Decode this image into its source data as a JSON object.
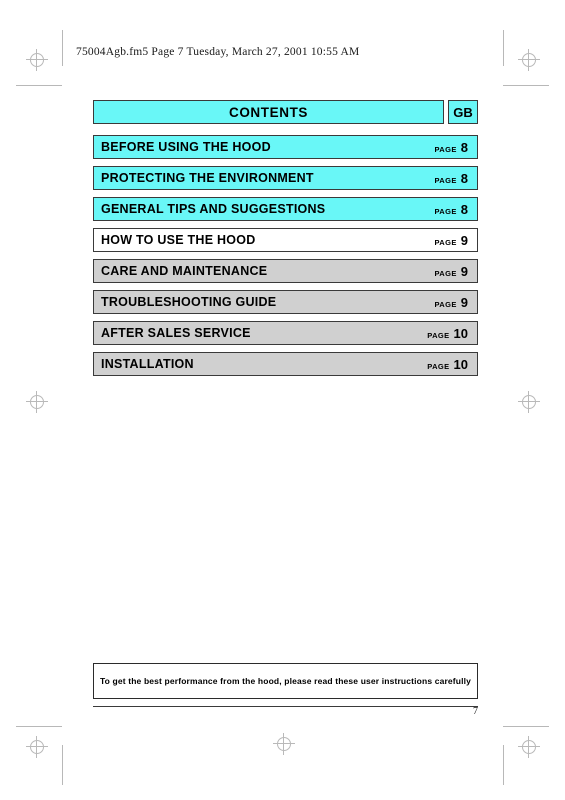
{
  "document": {
    "file_header": "75004Agb.fm5  Page 7  Tuesday, March 27, 2001  10:55 AM",
    "page_number": "7"
  },
  "contents": {
    "title": "CONTENTS",
    "language_code": "GB",
    "page_word": "PAGE",
    "items": [
      {
        "label": "BEFORE USING THE HOOD",
        "page": "8",
        "page_word": "PAGE",
        "fill": "cyan"
      },
      {
        "label": "PROTECTING THE ENVIRONMENT",
        "page": "8",
        "page_word": "PAGE",
        "fill": "cyan"
      },
      {
        "label": "GENERAL TIPS AND SUGGESTIONS",
        "page": "8",
        "page_word": "PAGE",
        "fill": "cyan"
      },
      {
        "label": "HOW TO USE THE HOOD",
        "page": "9",
        "page_word": "PAGE",
        "fill": "pale"
      },
      {
        "label": "CARE AND MAINTENANCE",
        "page": "9",
        "page_word": "PAGE",
        "fill": "gray"
      },
      {
        "label": "TROUBLESHOOTING GUIDE",
        "page": "9",
        "page_word": "PAGE",
        "fill": "gray"
      },
      {
        "label": "AFTER SALES SERVICE",
        "page": "10",
        "page_word": "PAGE",
        "fill": "gray"
      },
      {
        "label": "INSTALLATION",
        "page": "10",
        "page_word": "PAGE",
        "fill": "gray"
      }
    ]
  },
  "footer": {
    "note": "To get the best performance from the hood, please read these user instructions carefully"
  },
  "colors": {
    "accent_cyan": "#69f7f7",
    "row_gray": "#d0d0d0",
    "border": "#3a3a3a"
  }
}
